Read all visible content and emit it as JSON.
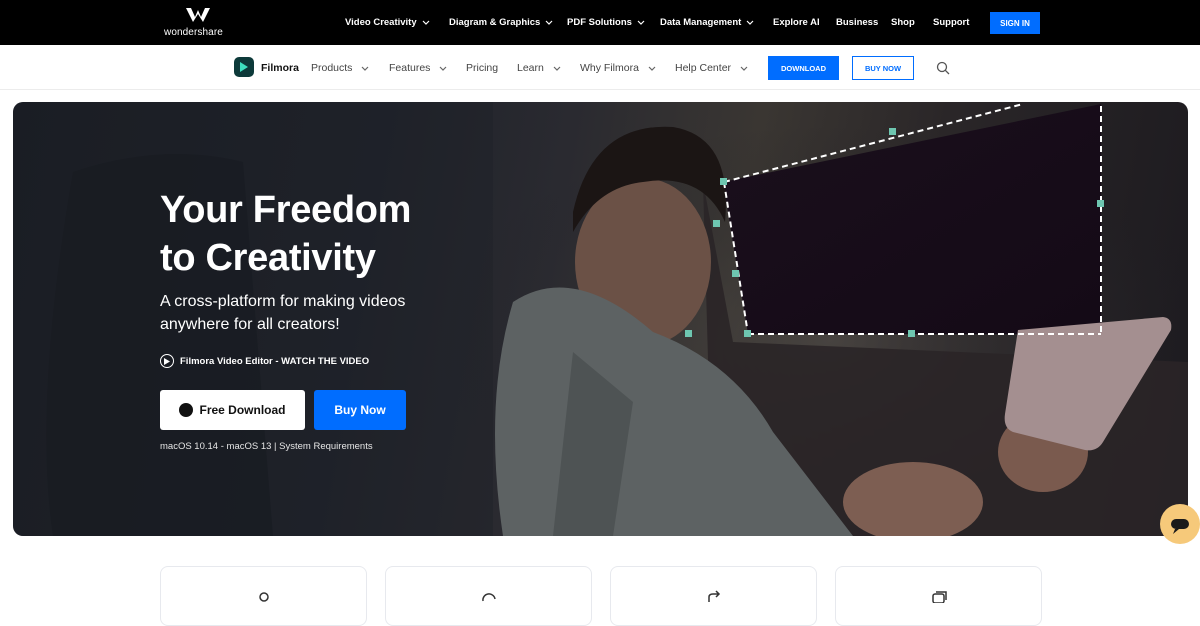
{
  "global_header": {
    "brand": "wondershare",
    "nav": [
      {
        "label": "Video Creativity",
        "dropdown": true
      },
      {
        "label": "Diagram & Graphics",
        "dropdown": true
      },
      {
        "label": "PDF Solutions",
        "dropdown": true
      },
      {
        "label": "Data Management",
        "dropdown": true
      },
      {
        "label": "Explore AI",
        "dropdown": false
      },
      {
        "label": "Business",
        "dropdown": false
      },
      {
        "label": "Shop",
        "dropdown": false
      },
      {
        "label": "Support",
        "dropdown": false
      }
    ],
    "sign_in": "SIGN IN"
  },
  "product_nav": {
    "product_name": "Filmora",
    "items": [
      {
        "label": "Products",
        "dropdown": true
      },
      {
        "label": "Features",
        "dropdown": true
      },
      {
        "label": "Pricing",
        "dropdown": false
      },
      {
        "label": "Learn",
        "dropdown": true
      },
      {
        "label": "Why Filmora",
        "dropdown": true
      },
      {
        "label": "Help Center",
        "dropdown": true
      }
    ],
    "download": "DOWNLOAD",
    "buy_now": "BUY NOW",
    "search_icon": "search-icon"
  },
  "hero": {
    "title_line1": "Your Freedom",
    "title_line2": "to Creativity",
    "subtitle": "A cross-platform for making videos anywhere for all creators!",
    "watch_link": "Filmora Video Editor - WATCH THE VIDEO",
    "free_download": "Free Download",
    "buy_now": "Buy Now",
    "system_info": "macOS 10.14 - macOS 13 | System Requirements"
  },
  "icons": {
    "chat": "chat-bubble-icon",
    "cards": [
      "person-icon",
      "refresh-icon",
      "share-icon",
      "layers-icon"
    ]
  },
  "colors": {
    "accent": "#006dff",
    "header_bg": "#000000",
    "chat_bubble": "#f6c97a",
    "selection_handle": "#6ec6b0"
  }
}
